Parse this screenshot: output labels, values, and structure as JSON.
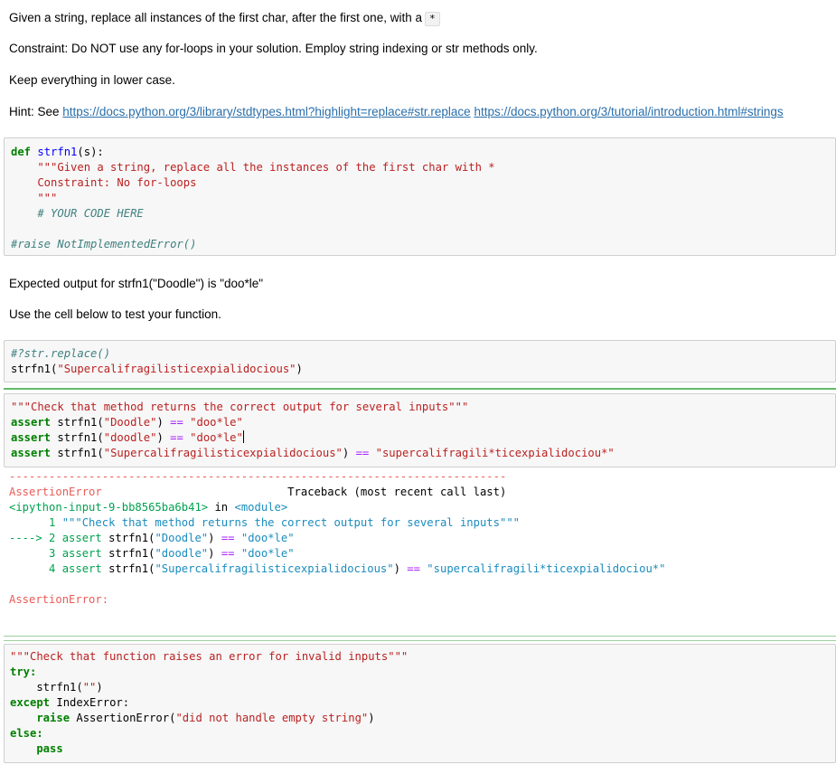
{
  "markdown": {
    "p1": "Given a string, replace all instances of the first char, after the first one, with a",
    "p1_code": "*",
    "p2": "Constraint: Do NOT use any for-loops in your solution. Employ string indexing or str methods only.",
    "p3": "Keep everything in lower case.",
    "hint_prefix": "Hint: See",
    "link1": "https://docs.python.org/3/library/stdtypes.html?highlight=replace#str.replace",
    "link2": "https://docs.python.org/3/tutorial/introduction.html#strings",
    "p4": "Expected output for strfn1(\"Doodle\") is \"doo*le\"",
    "p5": "Use the cell below to test your function."
  },
  "cell1": {
    "def": "def",
    "fname": "strfn1",
    "sig": "(s):",
    "doc1": "    \"\"\"Given a string, replace all the instances of the first char with *",
    "doc2": "    Constraint: No for-loops",
    "doc3": "    \"\"\"",
    "comment": "    # YOUR CODE HERE",
    "raise": "#raise NotImplementedError()"
  },
  "cell2": {
    "line1": "#?str.replace()",
    "call_name": "strfn1(",
    "call_arg": "\"Supercalifragilisticexpialidocious\"",
    "call_end": ")"
  },
  "cell3": {
    "doc": "\"\"\"Check that method returns the correct output for several inputs\"\"\"",
    "assert_kw": "assert",
    "a1_call": " strfn1(",
    "a1_arg": "\"Doodle\"",
    "a1_mid": ") ",
    "eq": "==",
    "a1_exp": " \"doo*le\"",
    "a2_arg": "\"doodle\"",
    "a2_exp": " \"doo*le\"",
    "a3_arg": "\"Supercalifragilisticexpialidocious\"",
    "a3_exp": " \"supercalifragili*ticexpialidociou*\""
  },
  "traceback": {
    "dashes": "---------------------------------------------------------------------------",
    "error": "AssertionError",
    "header_right": "                            Traceback (most recent call last)",
    "input_ref": "<ipython-input-9-bb8565ba6b41>",
    "in": " in ",
    "module": "<module>",
    "l1_no": "      1 ",
    "l1_code": "\"\"\"Check that method returns the correct output for several inputs\"\"\"",
    "l2_arrow": "----> 2 ",
    "l3_no": "      3 ",
    "l4_no": "      4 ",
    "final": "AssertionError:"
  },
  "cell4": {
    "doc": "\"\"\"Check that function raises an error for invalid inputs\"\"\"",
    "try": "try:",
    "call": "    strfn1(",
    "empty": "\"\"",
    "call_end": ")",
    "except": "except",
    "exc_name": " IndexError:",
    "raise": "    raise",
    "raise_cls": " AssertionError(",
    "raise_msg": "\"did not handle empty string\"",
    "raise_end": ")",
    "else": "else:",
    "pass": "    pass"
  }
}
